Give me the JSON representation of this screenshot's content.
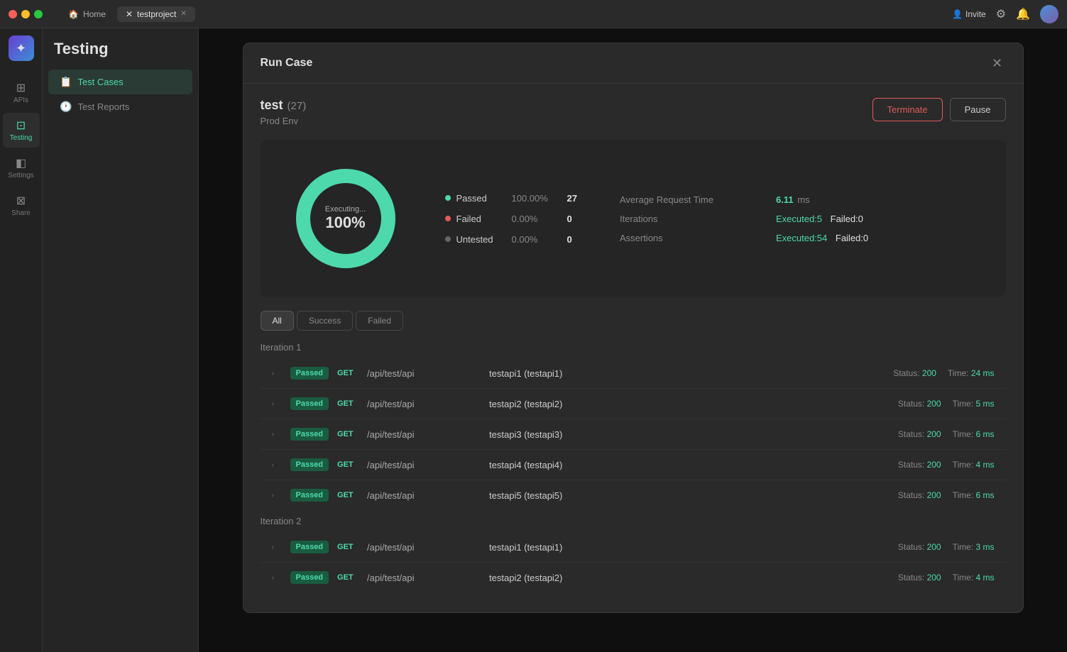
{
  "titlebar": {
    "tabs": [
      {
        "label": "Home",
        "active": false
      },
      {
        "label": "testproject",
        "active": true
      }
    ],
    "actions": {
      "invite_label": "Invite",
      "settings_icon": "⚙",
      "bell_icon": "🔔"
    }
  },
  "sidebar_narrow": {
    "items": [
      {
        "label": "APIs",
        "icon": "⊞",
        "active": false
      },
      {
        "label": "Testing",
        "icon": "⊡",
        "active": true
      },
      {
        "label": "Settings",
        "icon": "◧",
        "active": false
      },
      {
        "label": "Share",
        "icon": "⊠",
        "active": false
      }
    ]
  },
  "sidebar_wide": {
    "title": "Testing",
    "items": [
      {
        "label": "Test Cases",
        "icon": "📋",
        "active": true
      },
      {
        "label": "Test Reports",
        "icon": "🕐",
        "active": false
      }
    ]
  },
  "modal": {
    "title": "Run Case",
    "run_title": "test",
    "run_count": "(27)",
    "run_env": "Prod Env",
    "btn_terminate": "Terminate",
    "btn_pause": "Pause",
    "stats": {
      "donut_executing": "Executing...",
      "donut_percent": "100%",
      "legend": [
        {
          "label": "Passed",
          "percent": "100.00%",
          "count": "27",
          "color": "#4dd9ac"
        },
        {
          "label": "Failed",
          "percent": "0.00%",
          "count": "0",
          "color": "#e05a5a"
        },
        {
          "label": "Untested",
          "percent": "0.00%",
          "count": "0",
          "color": "#666"
        }
      ],
      "avg_request_time_label": "Average Request Time",
      "avg_request_time_val": "6.11",
      "avg_request_time_unit": "ms",
      "iterations_label": "Iterations",
      "iterations_val": "Executed:5  Failed:0",
      "assertions_label": "Assertions",
      "assertions_val": "Executed:54  Failed:0"
    },
    "filter_tabs": [
      {
        "label": "All",
        "active": true
      },
      {
        "label": "Success",
        "active": false
      },
      {
        "label": "Failed",
        "active": false
      }
    ],
    "iterations": [
      {
        "label": "Iteration 1",
        "rows": [
          {
            "status": "Passed",
            "method": "GET",
            "path": "/api/test/api",
            "name": "testapi1 (testapi1)",
            "http_status": "200",
            "time": "24 ms"
          },
          {
            "status": "Passed",
            "method": "GET",
            "path": "/api/test/api",
            "name": "testapi2 (testapi2)",
            "http_status": "200",
            "time": "5 ms"
          },
          {
            "status": "Passed",
            "method": "GET",
            "path": "/api/test/api",
            "name": "testapi3 (testapi3)",
            "http_status": "200",
            "time": "6 ms"
          },
          {
            "status": "Passed",
            "method": "GET",
            "path": "/api/test/api",
            "name": "testapi4 (testapi4)",
            "http_status": "200",
            "time": "4 ms"
          },
          {
            "status": "Passed",
            "method": "GET",
            "path": "/api/test/api",
            "name": "testapi5 (testapi5)",
            "http_status": "200",
            "time": "6 ms"
          }
        ]
      },
      {
        "label": "Iteration 2",
        "rows": [
          {
            "status": "Passed",
            "method": "GET",
            "path": "/api/test/api",
            "name": "testapi1 (testapi1)",
            "http_status": "200",
            "time": "3 ms"
          },
          {
            "status": "Passed",
            "method": "GET",
            "path": "/api/test/api",
            "name": "testapi2 (testapi2)",
            "http_status": "200",
            "time": "4 ms"
          }
        ]
      }
    ]
  }
}
